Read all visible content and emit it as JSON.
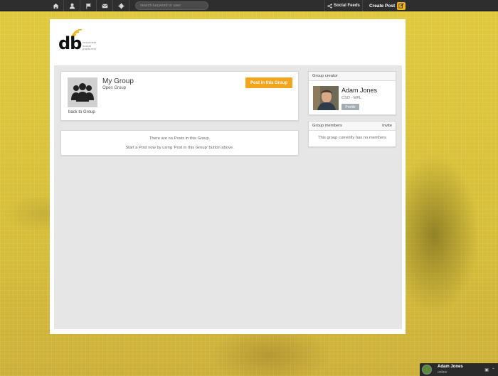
{
  "topbar": {
    "search_placeholder": "search keyword or user",
    "social_feeds_label": "Social Feeds",
    "create_post_label": "Create Post",
    "nav_icons": [
      "home-icon",
      "user-icon",
      "flag-icon",
      "mail-icon",
      "gear-icon"
    ]
  },
  "logo": {
    "mark": "db",
    "tagline": [
      "corporate",
      "social",
      "platforms"
    ]
  },
  "group": {
    "name": "My Group",
    "type": "Open Group",
    "back_label": "back to Group",
    "post_button_label": "Post in this Group"
  },
  "posts": {
    "empty_line1": "There are no Posts in this Group.",
    "empty_line2": "Start a Post now by using 'Post in this Group' button above."
  },
  "creator": {
    "header": "Group creator",
    "name": "Adam Jones",
    "role": "CSO - MPL",
    "profile_button": "Profile"
  },
  "members": {
    "header": "Group members",
    "invite_label": "Invite",
    "empty_text": "This group currently has no members"
  },
  "chat": {
    "name": "Adam Jones",
    "status": "online"
  },
  "colors": {
    "accent": "#f3a51d",
    "topbar": "#2e2e2e",
    "background": "#d9c23e"
  }
}
